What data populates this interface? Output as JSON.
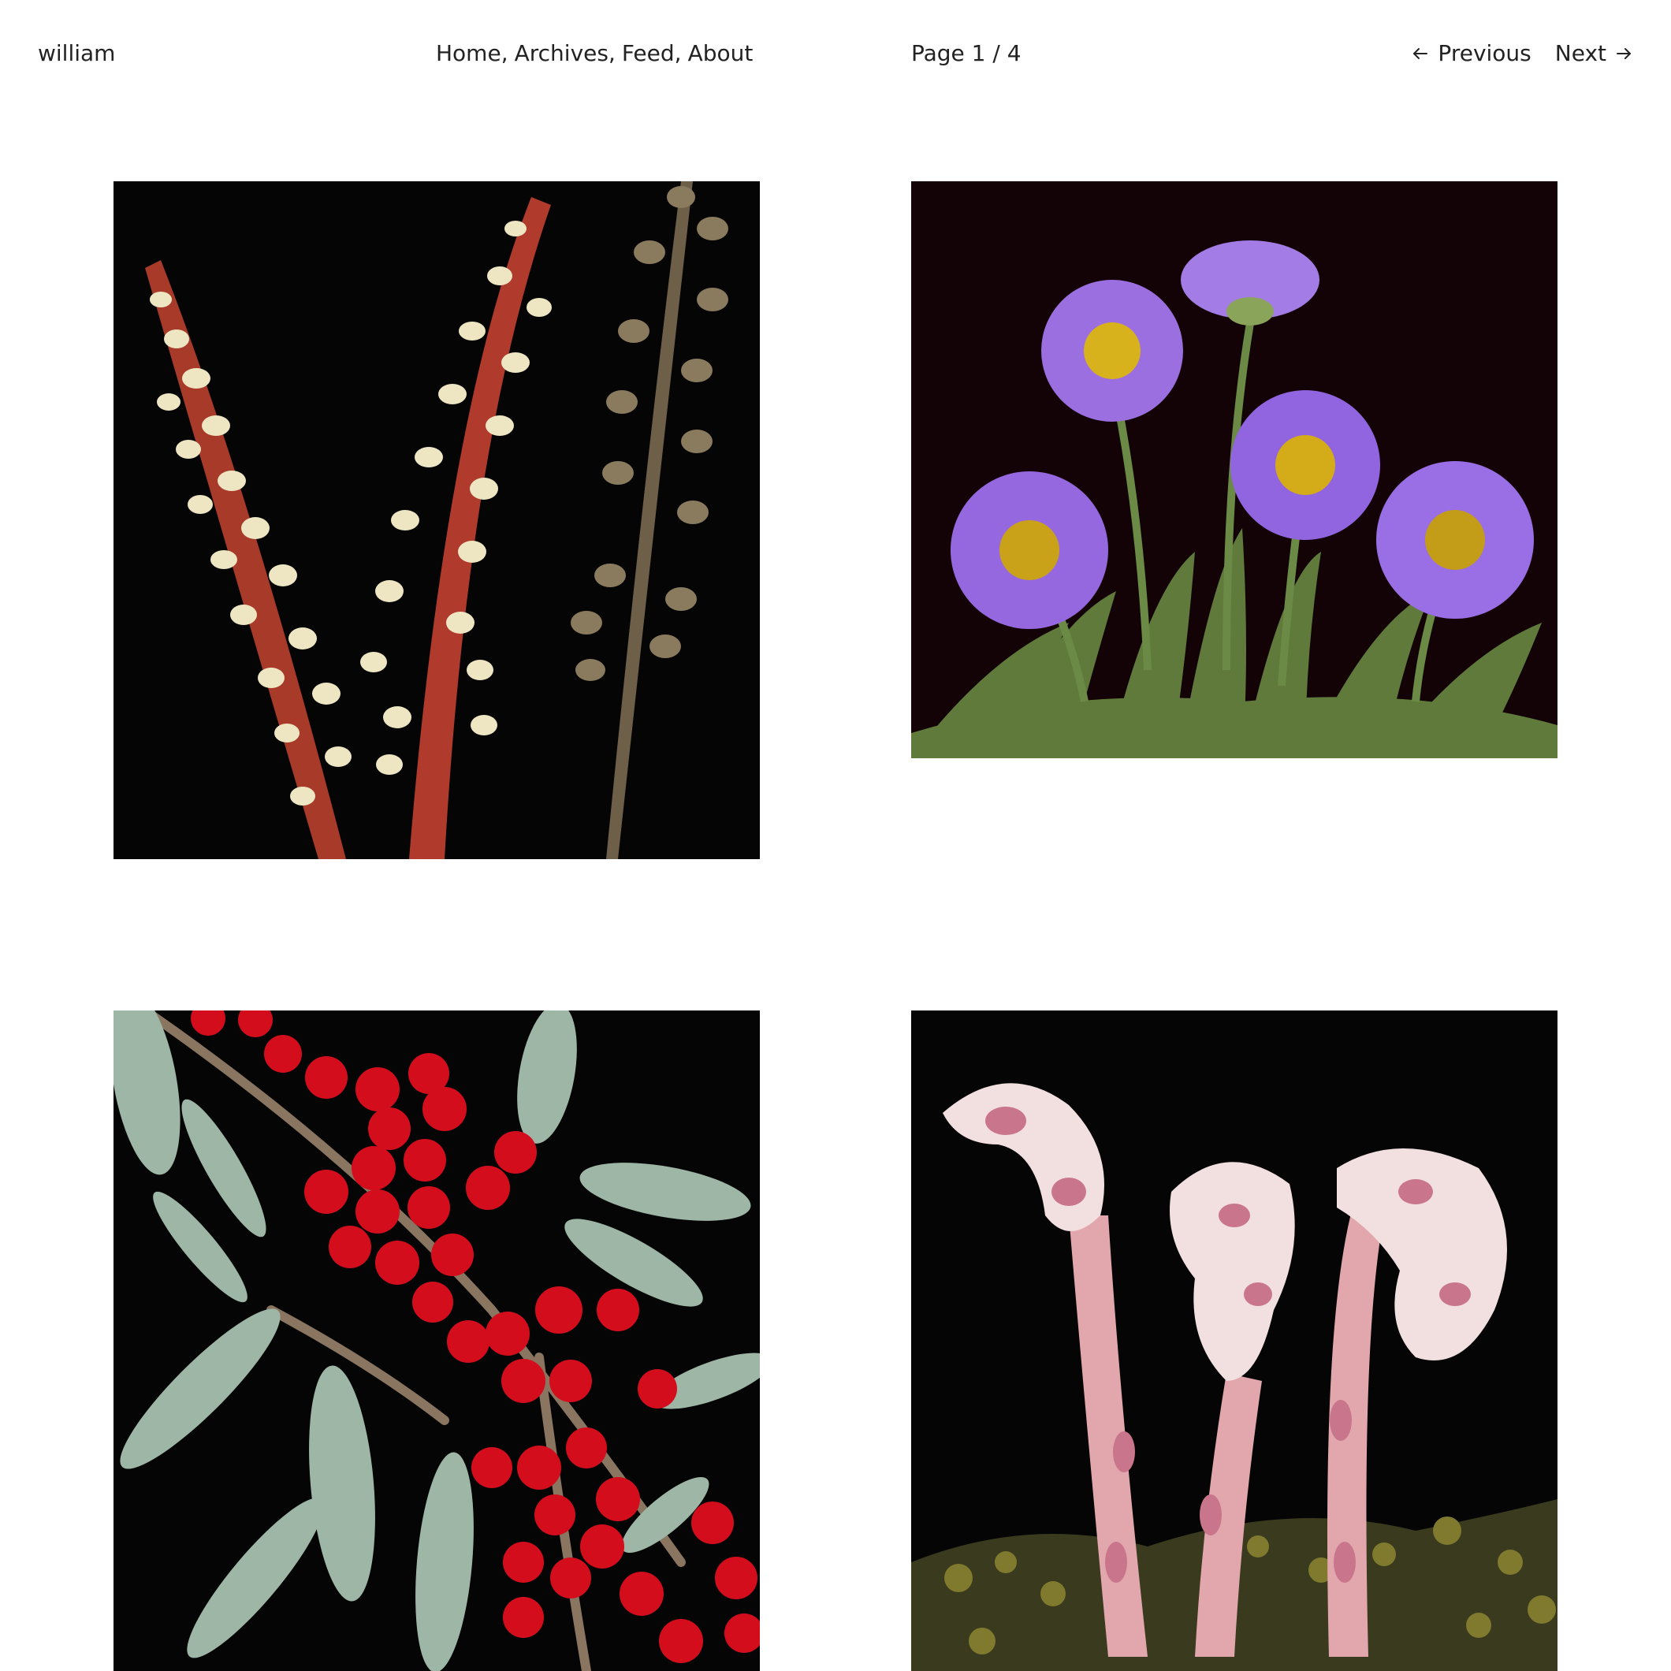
{
  "header": {
    "site_title": "william",
    "nav": [
      {
        "label": "Home",
        "sep": ","
      },
      {
        "label": "Archives",
        "sep": ","
      },
      {
        "label": "Feed",
        "sep": ","
      },
      {
        "label": "About",
        "sep": ""
      }
    ],
    "page_indicator": "Page 1 / 4",
    "pager": {
      "previous_label": "Previous",
      "next_label": "Next",
      "previous_icon": "arrow-left-icon",
      "next_icon": "arrow-right-icon"
    }
  },
  "gallery": {
    "photos": [
      {
        "subject": "pine-drops-flower-spikes",
        "background": "#050505"
      },
      {
        "subject": "purple-daisies",
        "background": "#120305"
      },
      {
        "subject": "red-berries-silver-leaves",
        "background": "#050505"
      },
      {
        "subject": "pinesap-pink-stalks",
        "background": "#050505"
      }
    ]
  }
}
